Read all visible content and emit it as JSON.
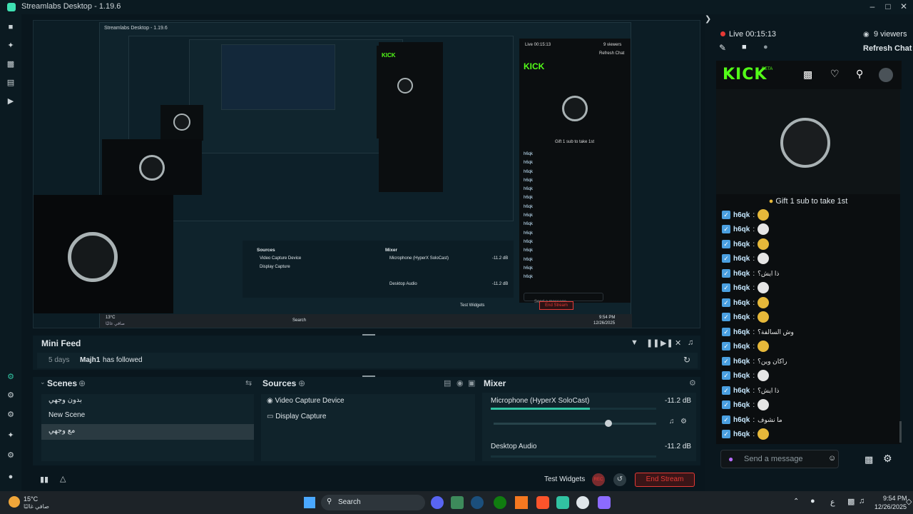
{
  "window": {
    "title": "Streamlabs Desktop - 1.19.6"
  },
  "nested": {
    "title": "Streamlabs Desktop - 1.19.6",
    "live": "Live 00:15:13",
    "viewers": "9 viewers",
    "refresh": "Refresh Chat",
    "kick": "KICK",
    "gift": "Gift 1 sub to take 1st",
    "send_placeholder": "Send a message",
    "sources_title": "Sources",
    "mixer_title": "Mixer",
    "source_items": [
      "Video Capture Device",
      "Display Capture"
    ],
    "mixer_channels": [
      {
        "name": "Microphone (HyperX SoloCast)",
        "db": "-11.2 dB"
      },
      {
        "name": "Desktop Audio",
        "db": "-11.2 dB"
      }
    ],
    "test_widgets": "Test Widgets",
    "end_stream": "End Stream",
    "taskbar_search": "Search",
    "temp": "13°C",
    "weather": "صافي غالبًا",
    "clock_time": "9:54 PM",
    "clock_date": "12/26/2025",
    "chat_user": "h6qk"
  },
  "chat": {
    "live_label": "Live 00:15:13",
    "viewers": "9 viewers",
    "refresh": "Refresh Chat",
    "kick_logo": "KICK",
    "kick_beta": "BETA",
    "gift": "Gift 1 sub to take 1st",
    "messages": [
      {
        "user": "h6qk",
        "sep": ":",
        "text": "",
        "emote": "gold"
      },
      {
        "user": "h6qk",
        "sep": ":",
        "text": "",
        "emote": "white"
      },
      {
        "user": "h6qk",
        "sep": ":",
        "text": "",
        "emote": "gold"
      },
      {
        "user": "h6qk",
        "sep": ":",
        "text": "",
        "emote": "white"
      },
      {
        "user": "h6qk",
        "sep": ":",
        "text": "ذا ايش؟",
        "emote": ""
      },
      {
        "user": "h6qk",
        "sep": ":",
        "text": "",
        "emote": "white"
      },
      {
        "user": "h6qk",
        "sep": ":",
        "text": "",
        "emote": "gold"
      },
      {
        "user": "h6qk",
        "sep": ":",
        "text": "",
        "emote": "gold"
      },
      {
        "user": "h6qk",
        "sep": ":",
        "text": "وش السالفة؟",
        "emote": ""
      },
      {
        "user": "h6qk",
        "sep": ":",
        "text": "",
        "emote": "gold"
      },
      {
        "user": "h6qk",
        "sep": ":",
        "text": "راكان وين؟",
        "emote": ""
      },
      {
        "user": "h6qk",
        "sep": ":",
        "text": "",
        "emote": "white"
      },
      {
        "user": "h6qk",
        "sep": ":",
        "text": "ذا ايش؟",
        "emote": ""
      },
      {
        "user": "h6qk",
        "sep": ":",
        "text": "",
        "emote": "white"
      },
      {
        "user": "h6qk",
        "sep": ":",
        "text": "ما نشوف",
        "emote": ""
      },
      {
        "user": "h6qk",
        "sep": ":",
        "text": "",
        "emote": "gold"
      }
    ],
    "send_placeholder": "Send a message"
  },
  "minifeed": {
    "title": "Mini Feed",
    "event_time": "5 days",
    "event_user": "Majh1",
    "event_action": "has followed"
  },
  "scenes": {
    "title": "Scenes",
    "items": [
      "بدون وجهي",
      "New Scene",
      "مع وجهي"
    ]
  },
  "sources": {
    "title": "Sources",
    "items": [
      "Video Capture Device",
      "Display Capture"
    ]
  },
  "mixer": {
    "title": "Mixer",
    "channels": [
      {
        "name": "Microphone (HyperX SoloCast)",
        "db": "-11.2 dB",
        "level": 0.6
      },
      {
        "name": "Desktop Audio",
        "db": "-11.2 dB",
        "level": 0
      }
    ]
  },
  "footer": {
    "test_widgets": "Test Widgets",
    "rec": "REC",
    "end_stream": "End Stream"
  },
  "taskbar": {
    "temp": "15°C",
    "weather": "صافي غالبًا",
    "search": "Search",
    "ime": "ع",
    "time": "9:54 PM",
    "date": "12/26/2025"
  },
  "colors": {
    "accent": "#31c3a2",
    "kick_green": "#53fc18",
    "live_red": "#e53935",
    "end_stream": "#e53935"
  }
}
